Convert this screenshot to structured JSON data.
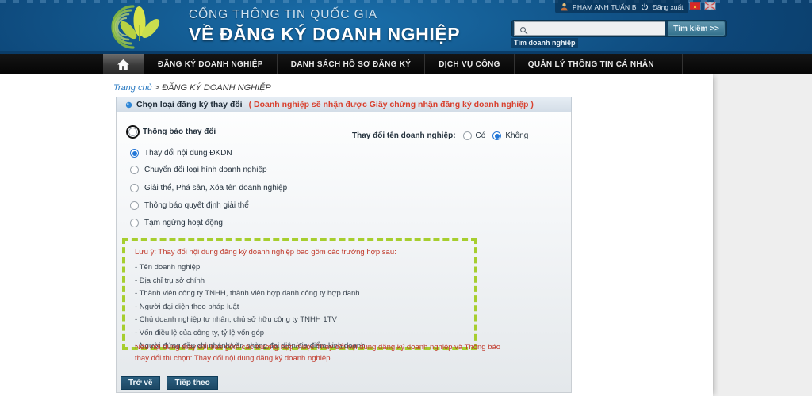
{
  "header": {
    "subtitle": "CỔNG THÔNG TIN QUỐC GIA",
    "title": "VỀ ĐĂNG KÝ DOANH NGHIỆP",
    "logo_icon": "leaf-swirl-logo",
    "user": {
      "avatar_icon": "user-avatar-icon",
      "name": "PHẠM ANH TUẤN B",
      "power_icon": "power-icon",
      "logout_label": "Đăng xuất"
    },
    "flags": [
      {
        "name": "flag-vietnam",
        "label": "VN"
      },
      {
        "name": "flag-english",
        "label": "EN"
      }
    ],
    "search": {
      "icon": "search-icon",
      "value": "",
      "placeholder": "",
      "button_label": "Tìm kiếm >>",
      "hint": "Tìm doanh nghiệp"
    }
  },
  "nav": {
    "home_icon": "home-icon",
    "items": [
      "ĐĂNG KÝ DOANH NGHIỆP",
      "DANH SÁCH HỒ SƠ ĐĂNG KÝ",
      "DỊCH VỤ CÔNG",
      "QUẢN LÝ THÔNG TIN CÁ NHÂN"
    ]
  },
  "breadcrumb": {
    "home": "Trang chủ",
    "separator": ">",
    "current": "ĐĂNG KÝ DOANH NGHIỆP"
  },
  "panel": {
    "bullet_icon": "bullet-blue-icon",
    "heading": "Chọn loại đăng ký thay đổi",
    "heading_note": "( Doanh nghiệp sẽ nhận được Giấy chứng nhận đăng ký doanh nghiệp )",
    "options": [
      {
        "label": "Thông báo thay đổi",
        "selected": false,
        "focused": true,
        "bold": true
      },
      {
        "label": "Thay đổi nội dung ĐKDN",
        "selected": true,
        "focused": false,
        "bold": false
      },
      {
        "label": "Chuyển đổi loại hình doanh nghiệp",
        "selected": false,
        "focused": false,
        "bold": false
      },
      {
        "label": "Giải thể, Phá sản, Xóa tên doanh nghiệp",
        "selected": false,
        "focused": false,
        "bold": false
      },
      {
        "label": "Thông báo quyết định giải thể",
        "selected": false,
        "focused": false,
        "bold": false
      },
      {
        "label": "Tạm ngừng hoạt động",
        "selected": false,
        "focused": false,
        "bold": false
      }
    ],
    "name_change": {
      "title": "Thay đổi tên doanh nghiệp:",
      "options": [
        {
          "label": "Có",
          "selected": false
        },
        {
          "label": "Không",
          "selected": true
        }
      ]
    },
    "note": {
      "border_color": "#a6ce2e",
      "title": "Lưu ý: Thay đổi nội dung đăng ký doanh nghiệp bao gồm các trường hợp sau:",
      "items": [
        "- Tên doanh nghiệp",
        "- Địa chỉ trụ sở chính",
        "- Thành viên công ty TNHH, thành viên hợp danh công ty hợp danh",
        "- Người đại diện theo pháp luật",
        "- Chủ doanh nghiệp tư nhân, chủ sở hữu công ty TNHH 1TV",
        "- Vốn điều lệ của công ty, tỷ lệ vốn góp",
        "- Người đứng đầu chi nhánh/văn phòng đại diện/địa điểm kinh doanh"
      ],
      "footer": "Nếu nội dung thay đổi bao gồm các trường hợp thuộc Thay đổi nội dung đăng ký doanh nghiệp và Thông báo thay đổi thì chọn: Thay đổi nội dung đăng ký doanh nghiệp"
    },
    "buttons": [
      {
        "label": "Trở về"
      },
      {
        "label": "Tiếp theo"
      }
    ]
  }
}
